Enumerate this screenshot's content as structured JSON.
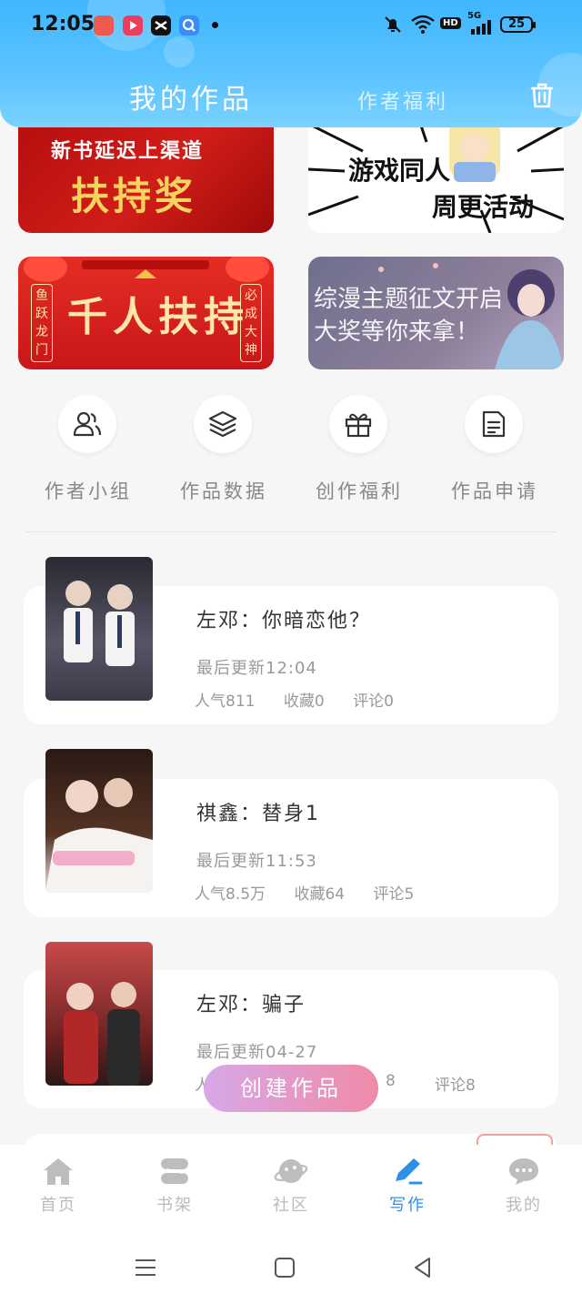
{
  "status_bar": {
    "time": "12:05",
    "battery": "25",
    "network": "5G",
    "hd_badge": "HD"
  },
  "header": {
    "tab_active": "我的作品",
    "tab_inactive": "作者福利",
    "accent_color": "#3fb6ff",
    "trash_icon": "trash-icon"
  },
  "banners": [
    {
      "name": "banner-delay-support",
      "top": "新书延迟上渠道",
      "main": "扶持奖"
    },
    {
      "name": "banner-game-fanfic",
      "main": "游戏同人",
      "sub": "周更活动"
    },
    {
      "name": "banner-thousand-support",
      "main": "千人扶持",
      "left": "鱼跃龙门",
      "right": "必成大神"
    },
    {
      "name": "banner-anime-contest",
      "line1": "综漫主题征文开启",
      "line2": "大奖等你来拿！"
    }
  ],
  "quick_actions": [
    {
      "label": "作者小组",
      "icon": "users-icon"
    },
    {
      "label": "作品数据",
      "icon": "layers-icon"
    },
    {
      "label": "创作福利",
      "icon": "gift-icon"
    },
    {
      "label": "作品申请",
      "icon": "document-icon"
    }
  ],
  "works": [
    {
      "title": "左邓：你暗恋他？",
      "updated": "最后更新12:04",
      "popularity": "人气811",
      "favorites": "收藏0",
      "comments": "评论0"
    },
    {
      "title": "祺鑫：替身1",
      "updated": "最后更新11:53",
      "popularity": "人气8.5万",
      "favorites": "收藏64",
      "comments": "评论5"
    },
    {
      "title": "左邓：骗子",
      "updated": "最后更新04-27",
      "popularity": "人",
      "favorites": "8",
      "comments": "评论8"
    }
  ],
  "fab": {
    "label": "创建作品"
  },
  "bottom_nav": [
    {
      "label": "首页",
      "icon": "home-icon"
    },
    {
      "label": "书架",
      "icon": "bookshelf-icon"
    },
    {
      "label": "社区",
      "icon": "planet-icon"
    },
    {
      "label": "写作",
      "icon": "pen-icon",
      "active": true
    },
    {
      "label": "我的",
      "icon": "chat-bubble-icon"
    }
  ],
  "colors": {
    "active_nav": "#2f8fe8",
    "fab_start": "#d7a8e8",
    "fab_end": "#f08aa8"
  }
}
